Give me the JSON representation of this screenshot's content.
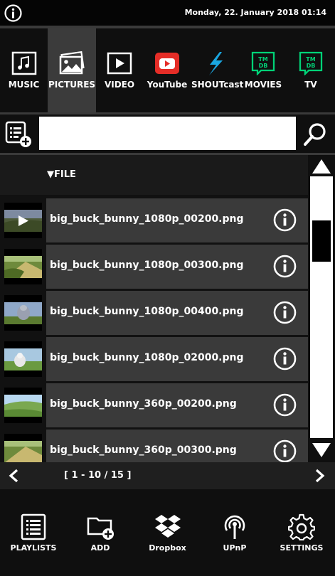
{
  "status": {
    "datetime": "Monday, 22. January 2018 01:14"
  },
  "tabs": [
    {
      "label": "MUSIC",
      "icon": "music-icon"
    },
    {
      "label": "PICTURES",
      "icon": "pictures-icon",
      "active": true
    },
    {
      "label": "VIDEO",
      "icon": "video-icon"
    },
    {
      "label": "YouTube",
      "icon": "youtube-icon"
    },
    {
      "label": "SHOUTcast",
      "icon": "shoutcast-icon"
    },
    {
      "label": "MOVIES",
      "icon": "tmdb-icon"
    },
    {
      "label": "TV",
      "icon": "tmdb-icon"
    }
  ],
  "tmdb": {
    "line1": "TM",
    "line2": "DB"
  },
  "search": {
    "value": "",
    "placeholder": ""
  },
  "list": {
    "sort_label": "FILE",
    "items": [
      {
        "name": "big_buck_bunny_1080p_00200.png"
      },
      {
        "name": "big_buck_bunny_1080p_00300.png"
      },
      {
        "name": "big_buck_bunny_1080p_00400.png"
      },
      {
        "name": "big_buck_bunny_1080p_02000.png"
      },
      {
        "name": "big_buck_bunny_360p_00200.png"
      },
      {
        "name": "big_buck_bunny_360p_00300.png"
      }
    ]
  },
  "pager": {
    "range": "[ 1 - 10 / 15 ]"
  },
  "bottom_nav": [
    {
      "label": "PLAYLISTS",
      "icon": "playlist-icon"
    },
    {
      "label": "ADD",
      "icon": "add-folder-icon"
    },
    {
      "label": "Dropbox",
      "icon": "dropbox-icon"
    },
    {
      "label": "UPnP",
      "icon": "upnp-icon"
    },
    {
      "label": "SETTINGS",
      "icon": "gear-icon"
    }
  ],
  "colors": {
    "background": "#111111",
    "active_tab": "#3b3b3b",
    "row_bg": "#3a3a3a",
    "youtube_red": "#e52d27",
    "shoutcast_blue": "#1aa6e0",
    "tmdb_green": "#01d277"
  }
}
